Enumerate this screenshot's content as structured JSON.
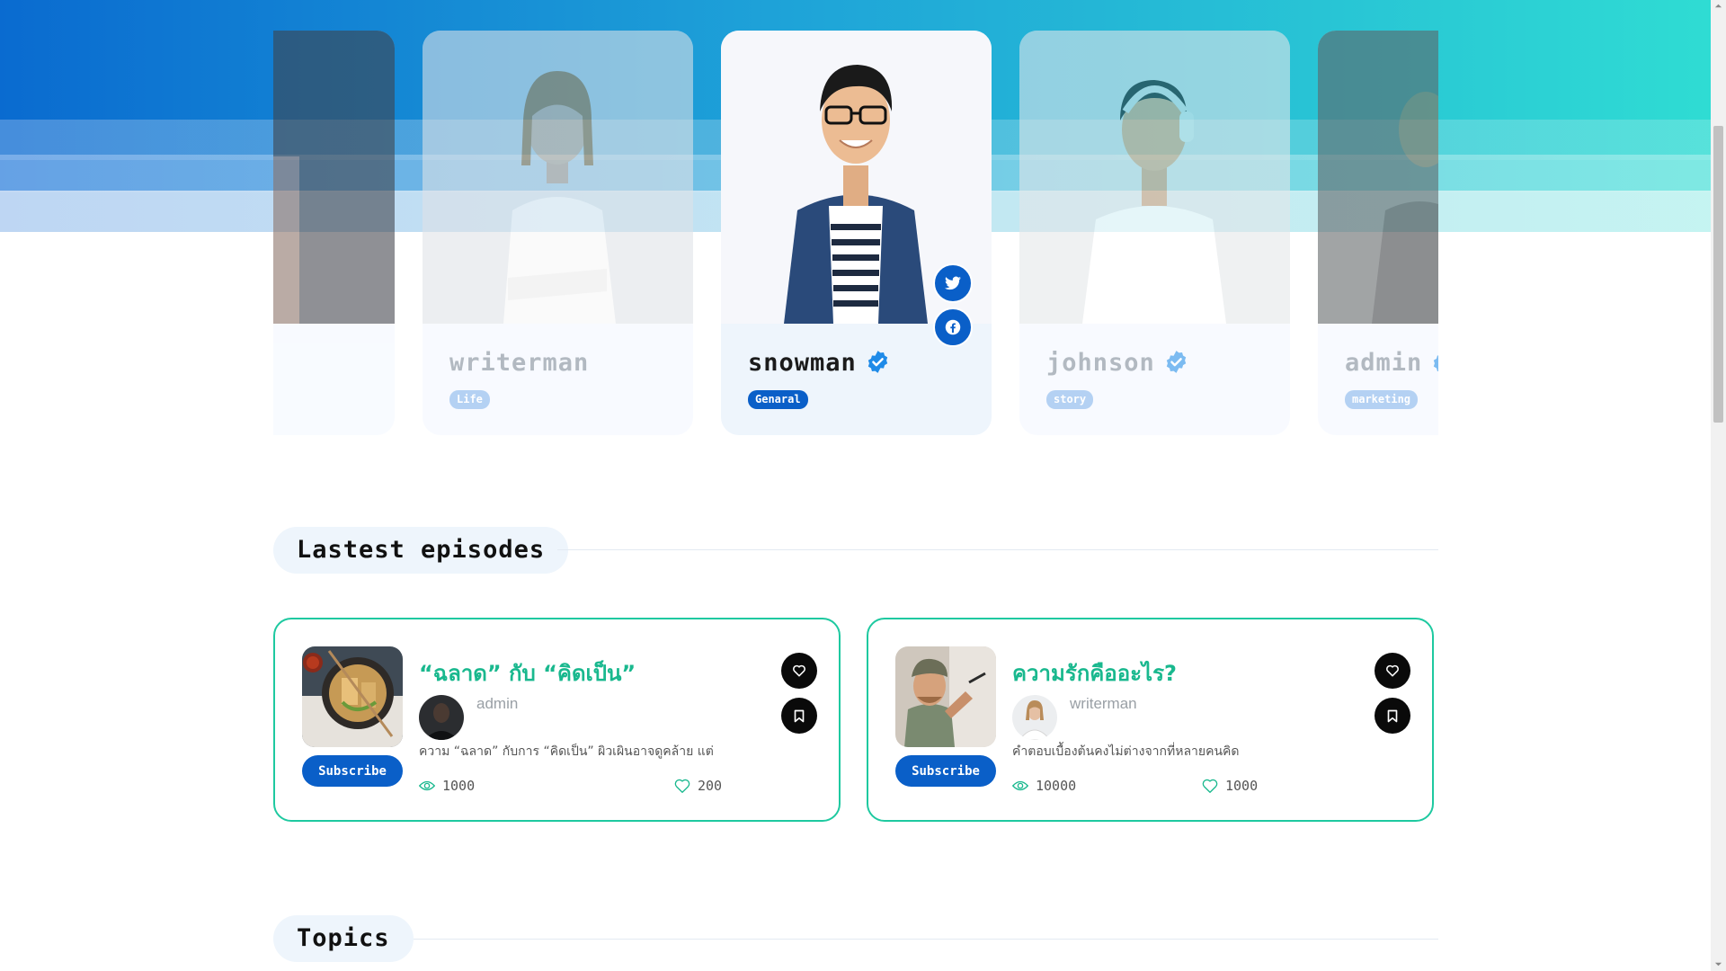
{
  "creators": [
    {
      "name": "",
      "category": "",
      "state": "partial-left"
    },
    {
      "name": "writerman",
      "category": "Life",
      "state": "dim"
    },
    {
      "name": "snowman",
      "category": "Genaral",
      "state": "active"
    },
    {
      "name": "johnson",
      "category": "story",
      "state": "dim"
    },
    {
      "name": "admin",
      "category": "marketing",
      "state": "partial-right"
    }
  ],
  "sections": {
    "latest_title": "Lastest episodes",
    "topics_title": "Topics"
  },
  "episodes": [
    {
      "title": "“ฉลาด” กับ “คิดเป็น”",
      "author": "admin",
      "description": "ความ “ฉลาด” กับการ “คิดเป็น” ผิวเผินอาจดูคล้าย แต่",
      "views": "1000",
      "likes": "200",
      "subscribe_label": "Subscribe"
    },
    {
      "title": "ความรักคืออะไร?",
      "author": "writerman",
      "description": "คำตอบเบื้องต้นคงไม่ต่างจากที่หลายคนคิด",
      "views": "10000",
      "likes": "1000",
      "subscribe_label": "Subscribe"
    }
  ],
  "icons": {
    "verified": "verified-badge-icon",
    "twitter": "twitter-icon",
    "facebook": "facebook-icon",
    "heart": "heart-icon",
    "bookmark": "bookmark-icon",
    "eye": "eye-icon"
  },
  "colors": {
    "brand_blue": "#0a5fc8",
    "accent_green": "#19b88e",
    "card_border": "#1ec9a0",
    "hero_gradient_start": "#0a6bd0",
    "hero_gradient_end": "#2fdcd3"
  }
}
